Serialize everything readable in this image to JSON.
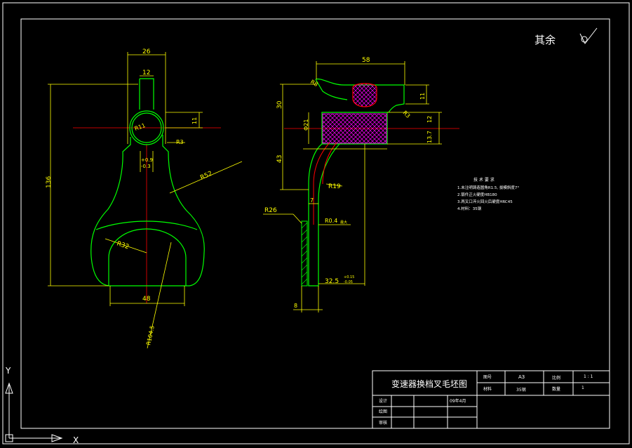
{
  "colors": {
    "background": "#000000",
    "frame": "#ffffff",
    "part_outline": "#00ff00",
    "dimension": "#ffff00",
    "centerline": "#ff0000",
    "hatch": "#ff00ff",
    "section_fill": "#ff0000",
    "note_text": "#ffffff"
  },
  "surface_finish": {
    "label": "其余",
    "symbol": "check-root-symbol"
  },
  "front_view": {
    "dims": {
      "top_width": "26",
      "slot_width": "12",
      "height": "136",
      "hole_offset": "11",
      "radius_hole": "R11",
      "radius_small": "R3",
      "tol_upper": "+0.9",
      "tol_lower": "-0.3",
      "radius_mid": "R52",
      "radius_fork_inner": "R32",
      "fork_width": "48",
      "radius_bottom": "R104.5"
    }
  },
  "side_view": {
    "dims": {
      "top_width": "58",
      "radius_top": "R8",
      "top_height": "11",
      "head_height": "30",
      "block_height": "12",
      "block_half": "13.7",
      "diameter": "Φ21",
      "radius_side": "R3",
      "web_height": "43",
      "radius_bend": "R19",
      "web_thickness": "7",
      "radius_left": "R26",
      "radius_small_tip": "R0.4",
      "note_small": "最大",
      "offset": "32.5",
      "offset_tol_upper": "+0.15",
      "offset_tol_lower": "-0.05",
      "bottom_thickness": "8"
    }
  },
  "tech_notes": {
    "title": "技 术 要 求",
    "items": [
      "1.未注明铸造圆角R1.5, 拔模斜度7°",
      "2.锻件正火硬度HB180",
      "3.两叉口淬火回火后硬度HRC45",
      "4.材料：35钢"
    ]
  },
  "title_block": {
    "drawing_title": "变速器换档叉毛坯图",
    "sheet_label": "图号",
    "sheet_value": "A3",
    "scale_label": "比例",
    "scale_value": "1 : 1",
    "material_label": "材料",
    "material_value": "35钢",
    "quantity_label": "数量",
    "quantity_value": "1",
    "design_label": "设计",
    "design_date": "09年4月",
    "draw_label": "绘图",
    "review_label": "审核"
  },
  "ucs": {
    "y_label": "Y",
    "x_label": "X"
  }
}
